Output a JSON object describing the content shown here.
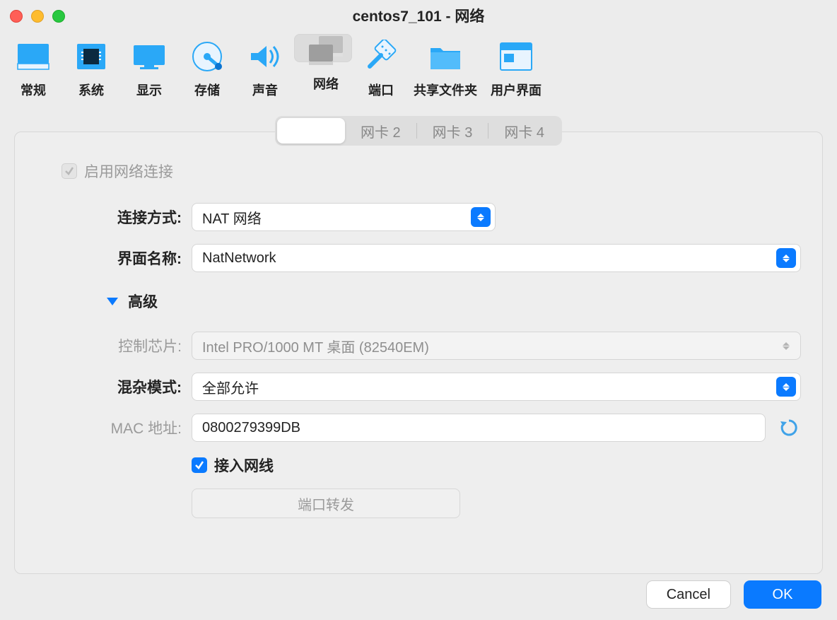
{
  "window": {
    "title": "centos7_101 - 网络"
  },
  "toolbar": {
    "items": [
      {
        "label": "常规"
      },
      {
        "label": "系统"
      },
      {
        "label": "显示"
      },
      {
        "label": "存储"
      },
      {
        "label": "声音"
      },
      {
        "label": "网络"
      },
      {
        "label": "端口"
      },
      {
        "label": "共享文件夹"
      },
      {
        "label": "用户界面"
      }
    ]
  },
  "tabs": [
    "",
    "网卡 2",
    "网卡 3",
    "网卡 4"
  ],
  "form": {
    "enable_label": "启用网络连接",
    "attach_label": "连接方式:",
    "attach_value": "NAT 网络",
    "name_label": "界面名称:",
    "name_value": "NatNetwork",
    "advanced": "高级",
    "adapter_label": "控制芯片:",
    "adapter_value": "Intel PRO/1000 MT 桌面 (82540EM)",
    "promisc_label": "混杂模式:",
    "promisc_value": "全部允许",
    "mac_label": "MAC 地址:",
    "mac_value": "0800279399DB",
    "cable_label": "接入网线",
    "portfwd": "端口转发"
  },
  "footer": {
    "cancel": "Cancel",
    "ok": "OK"
  }
}
